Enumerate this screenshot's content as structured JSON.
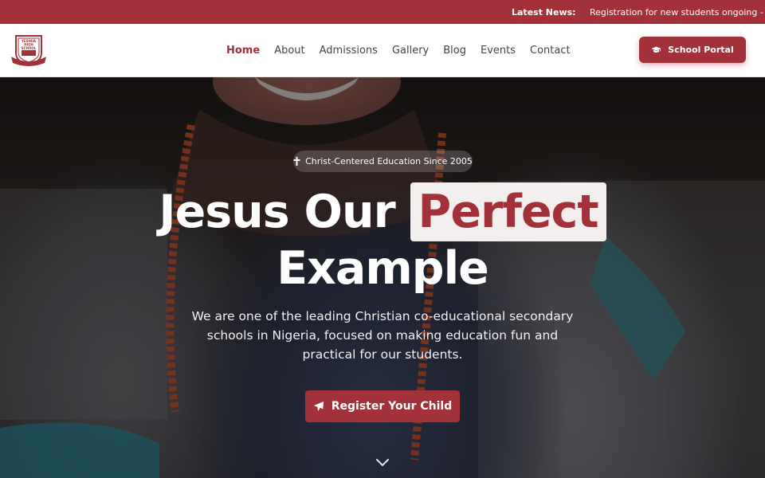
{
  "news": {
    "label": "Latest News:",
    "text": "Registration for new students ongoing - limit"
  },
  "header": {
    "logo_icon": "school-crest-logo",
    "logo_text": [
      "YESHUA",
      "HIGH",
      "SCHOOL"
    ],
    "nav": [
      {
        "label": "Home",
        "active": true
      },
      {
        "label": "About"
      },
      {
        "label": "Admissions"
      },
      {
        "label": "Gallery"
      },
      {
        "label": "Blog"
      },
      {
        "label": "Events"
      },
      {
        "label": "Contact"
      }
    ],
    "portal_button": {
      "label": "School Portal",
      "icon": "graduation-cap-icon"
    }
  },
  "hero": {
    "tagline": {
      "icon": "cross-icon",
      "text": "Christ-Centered Education Since 2005"
    },
    "headline": {
      "part1": "Jesus Our",
      "highlight": "Perfect",
      "part2": "Example"
    },
    "lede": "We are one of the leading Christian co-educational secondary schools in Nigeria, focused on making education fun and practical for our students.",
    "cta": {
      "label": "Register Your Child",
      "icon": "paper-plane-icon"
    },
    "scroll_icon": "chevron-down-icon"
  },
  "colors": {
    "brand": "#a3313a",
    "header_bg": "#ffffff",
    "highlight_bg": "#f3efee"
  }
}
